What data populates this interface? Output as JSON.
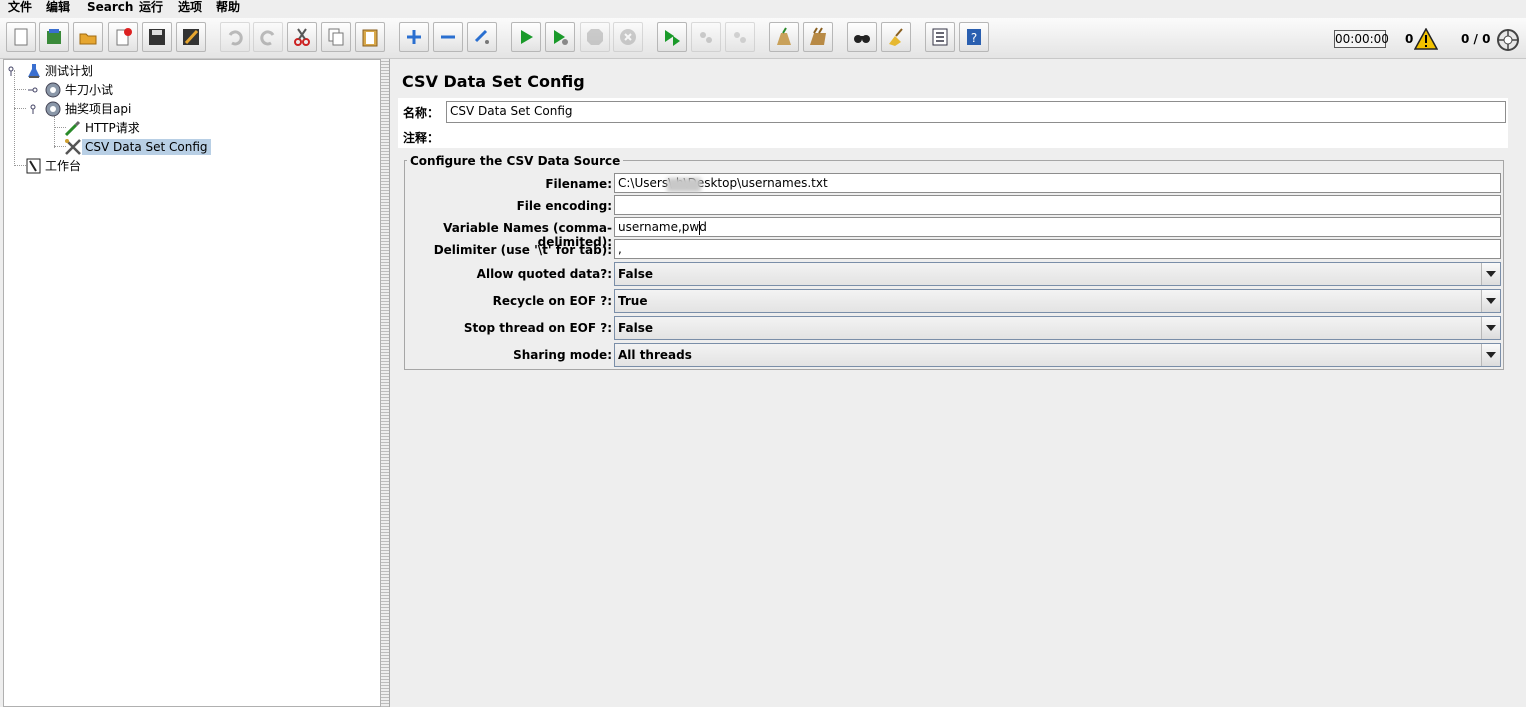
{
  "menu": [
    "文件",
    "编辑",
    "Search",
    "运行",
    "选项",
    "帮助"
  ],
  "toolbar": {
    "buttons": [
      {
        "name": "new-icon"
      },
      {
        "name": "templates-icon"
      },
      {
        "name": "open-icon"
      },
      {
        "name": "close-icon"
      },
      {
        "name": "save-icon"
      },
      {
        "name": "save-as-icon"
      },
      {
        "name": "undo-icon"
      },
      {
        "name": "redo-icon"
      },
      {
        "name": "cut-icon"
      },
      {
        "name": "copy-icon"
      },
      {
        "name": "paste-icon"
      },
      {
        "name": "expand-icon"
      },
      {
        "name": "collapse-icon"
      },
      {
        "name": "toggle-icon"
      },
      {
        "name": "start-icon"
      },
      {
        "name": "start-no-pause-icon"
      },
      {
        "name": "stop-icon"
      },
      {
        "name": "shutdown-icon"
      },
      {
        "name": "remote-start-icon"
      },
      {
        "name": "remote-stop-icon"
      },
      {
        "name": "remote-shutdown-icon"
      },
      {
        "name": "clear-icon"
      },
      {
        "name": "clear-all-icon"
      },
      {
        "name": "search-icon"
      },
      {
        "name": "reset-search-icon"
      },
      {
        "name": "function-helper-icon"
      },
      {
        "name": "help-icon"
      }
    ],
    "timer": "00:00:00",
    "error_count": "0",
    "threads": "0 / 0"
  },
  "tree": {
    "plan": "测试计划",
    "group1": "牛刀小试",
    "group2": "抽奖项目api",
    "http": "HTTP请求",
    "csv": "CSV Data Set Config",
    "workbench": "工作台"
  },
  "panel": {
    "title": "CSV Data Set Config",
    "name_label": "名称：",
    "name_value": "CSV Data Set Config",
    "comment_label": "注释：",
    "comment_value": "",
    "section": "Configure the CSV Data Source",
    "fields": {
      "filename_label": "Filename:",
      "filename_value": "C:\\Users\\        h\\Desktop\\usernames.txt",
      "encoding_label": "File encoding:",
      "encoding_value": "",
      "varnames_label": "Variable Names (comma-delimited):",
      "varnames_value": "username,pwd",
      "delimiter_label": "Delimiter (use '\\t' for tab):",
      "delimiter_value": ",",
      "quoted_label": "Allow quoted data?:",
      "quoted_value": "False",
      "recycle_label": "Recycle on EOF ?:",
      "recycle_value": "True",
      "stopthread_label": "Stop thread on EOF ?:",
      "stopthread_value": "False",
      "sharing_label": "Sharing mode:",
      "sharing_value": "All threads"
    }
  }
}
